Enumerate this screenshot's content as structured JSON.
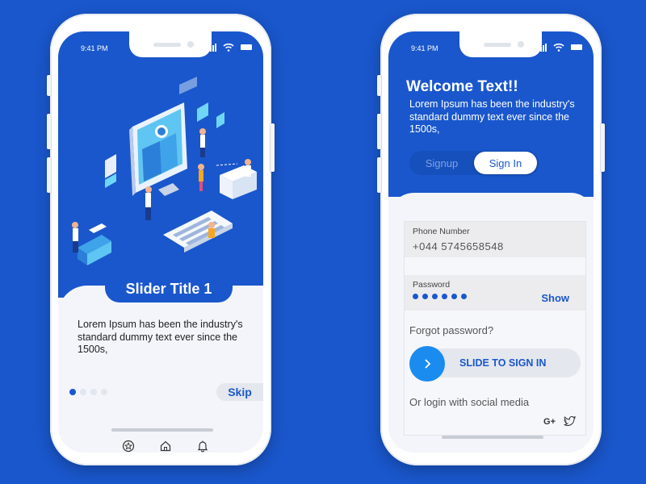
{
  "colors": {
    "brand_blue": "#1a57cc",
    "accent_blue": "#1a8cf0",
    "light_bg": "#f3f5fa"
  },
  "left_phone": {
    "status_time": "9:41 PM",
    "slider_title": "Slider Title 1",
    "slider_text": "Lorem Ipsum has been the industry's standard dummy text ever since the 1500s,",
    "pagination": {
      "total": 4,
      "active_index": 0
    },
    "skip_label": "Skip",
    "tabbar_icons": [
      "star-icon",
      "home-icon",
      "bell-icon"
    ]
  },
  "right_phone": {
    "status_time": "9:41 PM",
    "welcome_title": "Welcome Text!!",
    "welcome_text": "Lorem Ipsum has been the industry's standard dummy text ever since the 1500s,",
    "tabs": {
      "signup": "Signup",
      "signin": "Sign In",
      "active": "signin"
    },
    "phone_field": {
      "label": "Phone Number",
      "value": "+044  5745658548"
    },
    "password_field": {
      "label": "Password",
      "masked_length": 6,
      "show_label": "Show"
    },
    "forgot_password": "Forgot password?",
    "slide_to_sign_in": "SLIDE TO SIGN IN",
    "social_text": "Or login with social media",
    "social_icons": [
      "google-plus-icon",
      "twitter-icon"
    ],
    "google_plus_glyph": "G+"
  }
}
